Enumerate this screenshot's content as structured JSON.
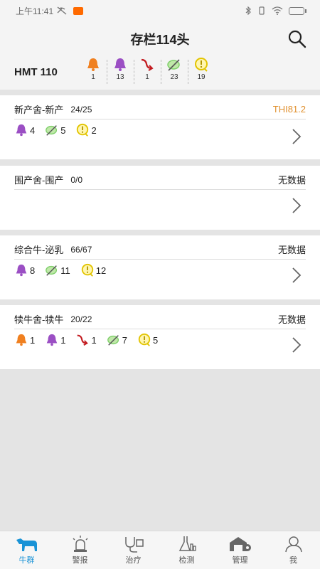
{
  "status_bar": {
    "time": "上午11:41"
  },
  "header": {
    "title": "存栏114头"
  },
  "summary": {
    "farm": "HMT 110",
    "items": [
      {
        "icon": "orange-bell-icon",
        "count": "1"
      },
      {
        "icon": "purple-bell-icon",
        "count": "13"
      },
      {
        "icon": "red-arrow-icon",
        "count": "1"
      },
      {
        "icon": "green-thermometer-icon",
        "count": "23"
      },
      {
        "icon": "yellow-alert-icon",
        "count": "19"
      }
    ]
  },
  "groups": [
    {
      "name": "新产舍-新产",
      "count": "24/25",
      "thi": "THI81.2",
      "alerts": [
        {
          "type": "purple-bell",
          "count": "4"
        },
        {
          "type": "green-thermometer",
          "count": "5"
        },
        {
          "type": "yellow-alert",
          "count": "2"
        }
      ]
    },
    {
      "name": "围产舍-围产",
      "count": "0/0",
      "thi": "无数据",
      "alerts": []
    },
    {
      "name": "综合牛-泌乳",
      "count": "66/67",
      "thi": "无数据",
      "alerts": [
        {
          "type": "purple-bell",
          "count": "8"
        },
        {
          "type": "green-thermometer",
          "count": "11"
        },
        {
          "type": "yellow-alert",
          "count": "12"
        }
      ]
    },
    {
      "name": "犊牛舍-犊牛",
      "count": "20/22",
      "thi": "无数据",
      "alerts": [
        {
          "type": "orange-bell",
          "count": "1"
        },
        {
          "type": "purple-bell",
          "count": "1"
        },
        {
          "type": "red-arrow",
          "count": "1"
        },
        {
          "type": "green-thermometer",
          "count": "7"
        },
        {
          "type": "yellow-alert",
          "count": "5"
        }
      ]
    }
  ],
  "tabs": [
    {
      "label": "牛群",
      "icon": "cow-icon",
      "active": true
    },
    {
      "label": "警报",
      "icon": "siren-icon"
    },
    {
      "label": "治疗",
      "icon": "stethoscope-icon"
    },
    {
      "label": "检测",
      "icon": "flask-icon"
    },
    {
      "label": "管理",
      "icon": "barn-gear-icon"
    },
    {
      "label": "我",
      "icon": "person-icon"
    }
  ],
  "colors": {
    "orange": "#f08020",
    "purple": "#9b4fc4",
    "red": "#c2191e",
    "green": "#7fcf6a",
    "yellow": "#e2c400",
    "accent": "#1a93d6",
    "thi_orange": "#e0902e"
  }
}
